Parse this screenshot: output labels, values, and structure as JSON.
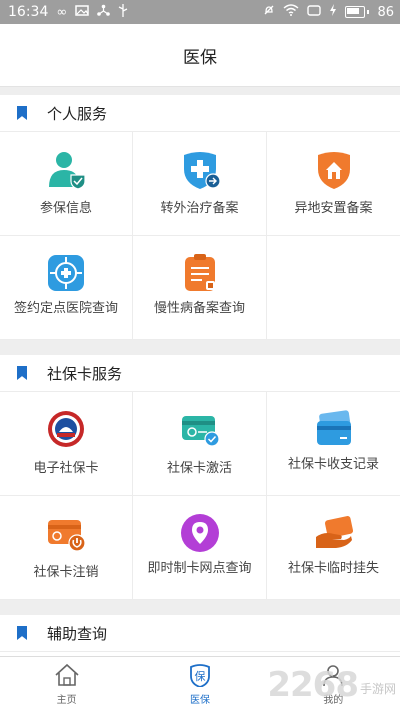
{
  "status_bar": {
    "time": "16:34",
    "battery": "86"
  },
  "header": {
    "title": "医保"
  },
  "sections": [
    {
      "title": "个人服务",
      "items": [
        {
          "label": "参保信息",
          "icon": "user-shield-icon"
        },
        {
          "label": "转外治疗备案",
          "icon": "medical-shield-transfer-icon"
        },
        {
          "label": "异地安置备案",
          "icon": "house-shield-icon"
        },
        {
          "label": "签约定点医院查询",
          "icon": "hospital-locate-icon"
        },
        {
          "label": "慢性病备案查询",
          "icon": "clipboard-icon"
        }
      ]
    },
    {
      "title": "社保卡服务",
      "items": [
        {
          "label": "电子社保卡",
          "icon": "social-security-emblem-icon"
        },
        {
          "label": "社保卡激活",
          "icon": "card-check-icon"
        },
        {
          "label": "社保卡收支记录",
          "icon": "cards-record-icon"
        },
        {
          "label": "社保卡注销",
          "icon": "card-power-icon"
        },
        {
          "label": "即时制卡网点查询",
          "icon": "location-pin-icon"
        },
        {
          "label": "社保卡临时挂失",
          "icon": "hand-card-icon"
        }
      ]
    },
    {
      "title": "辅助查询",
      "items": []
    }
  ],
  "tabs": [
    {
      "label": "主页",
      "icon": "home-icon"
    },
    {
      "label": "医保",
      "icon": "bao-badge-icon",
      "active": true
    },
    {
      "label": "我的",
      "icon": "person-icon"
    }
  ],
  "watermark": {
    "big": "2268",
    "small": "手游网"
  },
  "colors": {
    "accent": "#1e6fc8",
    "teal": "#2bb5a6",
    "orange": "#f07a2d",
    "purple": "#b33ed6"
  }
}
